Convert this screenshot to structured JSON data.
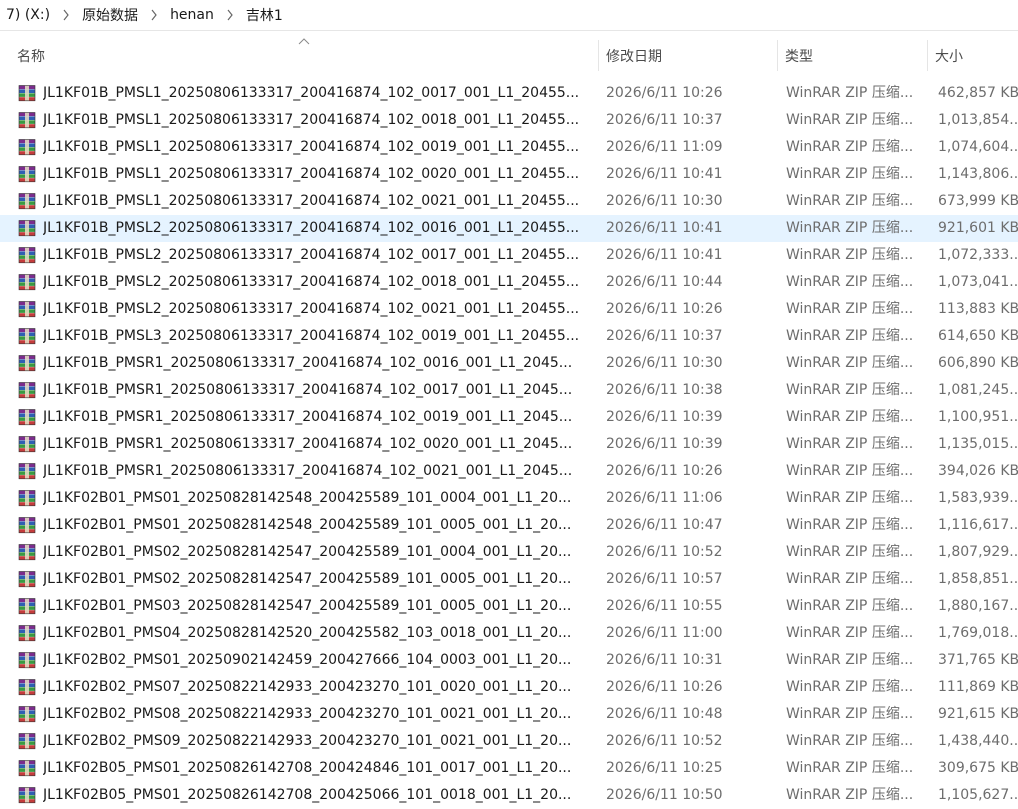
{
  "breadcrumb": {
    "drive": "7) (X:)",
    "items": [
      "原始数据",
      "henan",
      "吉林1"
    ]
  },
  "columns": {
    "name": "名称",
    "date": "修改日期",
    "type": "类型",
    "size": "大小"
  },
  "selected_index": 5,
  "files": [
    {
      "name": "JL1KF01B_PMSL1_20250806133317_200416874_102_0017_001_L1_20455...",
      "date": "2026/6/11 10:26",
      "type": "WinRAR ZIP 压缩...",
      "size": "462,857 KB"
    },
    {
      "name": "JL1KF01B_PMSL1_20250806133317_200416874_102_0018_001_L1_20455...",
      "date": "2026/6/11 10:37",
      "type": "WinRAR ZIP 压缩...",
      "size": "1,013,854..."
    },
    {
      "name": "JL1KF01B_PMSL1_20250806133317_200416874_102_0019_001_L1_20455...",
      "date": "2026/6/11 11:09",
      "type": "WinRAR ZIP 压缩...",
      "size": "1,074,604..."
    },
    {
      "name": "JL1KF01B_PMSL1_20250806133317_200416874_102_0020_001_L1_20455...",
      "date": "2026/6/11 10:41",
      "type": "WinRAR ZIP 压缩...",
      "size": "1,143,806..."
    },
    {
      "name": "JL1KF01B_PMSL1_20250806133317_200416874_102_0021_001_L1_20455...",
      "date": "2026/6/11 10:30",
      "type": "WinRAR ZIP 压缩...",
      "size": "673,999 KB"
    },
    {
      "name": "JL1KF01B_PMSL2_20250806133317_200416874_102_0016_001_L1_20455...",
      "date": "2026/6/11 10:41",
      "type": "WinRAR ZIP 压缩...",
      "size": "921,601 KB"
    },
    {
      "name": "JL1KF01B_PMSL2_20250806133317_200416874_102_0017_001_L1_20455...",
      "date": "2026/6/11 10:41",
      "type": "WinRAR ZIP 压缩...",
      "size": "1,072,333..."
    },
    {
      "name": "JL1KF01B_PMSL2_20250806133317_200416874_102_0018_001_L1_20455...",
      "date": "2026/6/11 10:44",
      "type": "WinRAR ZIP 压缩...",
      "size": "1,073,041..."
    },
    {
      "name": "JL1KF01B_PMSL2_20250806133317_200416874_102_0021_001_L1_20455...",
      "date": "2026/6/11 10:26",
      "type": "WinRAR ZIP 压缩...",
      "size": "113,883 KB"
    },
    {
      "name": "JL1KF01B_PMSL3_20250806133317_200416874_102_0019_001_L1_20455...",
      "date": "2026/6/11 10:37",
      "type": "WinRAR ZIP 压缩...",
      "size": "614,650 KB"
    },
    {
      "name": "JL1KF01B_PMSR1_20250806133317_200416874_102_0016_001_L1_2045...",
      "date": "2026/6/11 10:30",
      "type": "WinRAR ZIP 压缩...",
      "size": "606,890 KB"
    },
    {
      "name": "JL1KF01B_PMSR1_20250806133317_200416874_102_0017_001_L1_2045...",
      "date": "2026/6/11 10:38",
      "type": "WinRAR ZIP 压缩...",
      "size": "1,081,245..."
    },
    {
      "name": "JL1KF01B_PMSR1_20250806133317_200416874_102_0019_001_L1_2045...",
      "date": "2026/6/11 10:39",
      "type": "WinRAR ZIP 压缩...",
      "size": "1,100,951..."
    },
    {
      "name": "JL1KF01B_PMSR1_20250806133317_200416874_102_0020_001_L1_2045...",
      "date": "2026/6/11 10:39",
      "type": "WinRAR ZIP 压缩...",
      "size": "1,135,015..."
    },
    {
      "name": "JL1KF01B_PMSR1_20250806133317_200416874_102_0021_001_L1_2045...",
      "date": "2026/6/11 10:26",
      "type": "WinRAR ZIP 压缩...",
      "size": "394,026 KB"
    },
    {
      "name": "JL1KF02B01_PMS01_20250828142548_200425589_101_0004_001_L1_20...",
      "date": "2026/6/11 11:06",
      "type": "WinRAR ZIP 压缩...",
      "size": "1,583,939..."
    },
    {
      "name": "JL1KF02B01_PMS01_20250828142548_200425589_101_0005_001_L1_20...",
      "date": "2026/6/11 10:47",
      "type": "WinRAR ZIP 压缩...",
      "size": "1,116,617..."
    },
    {
      "name": "JL1KF02B01_PMS02_20250828142547_200425589_101_0004_001_L1_20...",
      "date": "2026/6/11 10:52",
      "type": "WinRAR ZIP 压缩...",
      "size": "1,807,929..."
    },
    {
      "name": "JL1KF02B01_PMS02_20250828142547_200425589_101_0005_001_L1_20...",
      "date": "2026/6/11 10:57",
      "type": "WinRAR ZIP 压缩...",
      "size": "1,858,851..."
    },
    {
      "name": "JL1KF02B01_PMS03_20250828142547_200425589_101_0005_001_L1_20...",
      "date": "2026/6/11 10:55",
      "type": "WinRAR ZIP 压缩...",
      "size": "1,880,167..."
    },
    {
      "name": "JL1KF02B01_PMS04_20250828142520_200425582_103_0018_001_L1_20...",
      "date": "2026/6/11 11:00",
      "type": "WinRAR ZIP 压缩...",
      "size": "1,769,018..."
    },
    {
      "name": "JL1KF02B02_PMS01_20250902142459_200427666_104_0003_001_L1_20...",
      "date": "2026/6/11 10:31",
      "type": "WinRAR ZIP 压缩...",
      "size": "371,765 KB"
    },
    {
      "name": "JL1KF02B02_PMS07_20250822142933_200423270_101_0020_001_L1_20...",
      "date": "2026/6/11 10:26",
      "type": "WinRAR ZIP 压缩...",
      "size": "111,869 KB"
    },
    {
      "name": "JL1KF02B02_PMS08_20250822142933_200423270_101_0021_001_L1_20...",
      "date": "2026/6/11 10:48",
      "type": "WinRAR ZIP 压缩...",
      "size": "921,615 KB"
    },
    {
      "name": "JL1KF02B02_PMS09_20250822142933_200423270_101_0021_001_L1_20...",
      "date": "2026/6/11 10:52",
      "type": "WinRAR ZIP 压缩...",
      "size": "1,438,440..."
    },
    {
      "name": "JL1KF02B05_PMS01_20250826142708_200424846_101_0017_001_L1_20...",
      "date": "2026/6/11 10:25",
      "type": "WinRAR ZIP 压缩...",
      "size": "309,675 KB"
    },
    {
      "name": "JL1KF02B05_PMS01_20250826142708_200425066_101_0018_001_L1_20...",
      "date": "2026/6/11 10:50",
      "type": "WinRAR ZIP 压缩...",
      "size": "1,105,627..."
    }
  ]
}
